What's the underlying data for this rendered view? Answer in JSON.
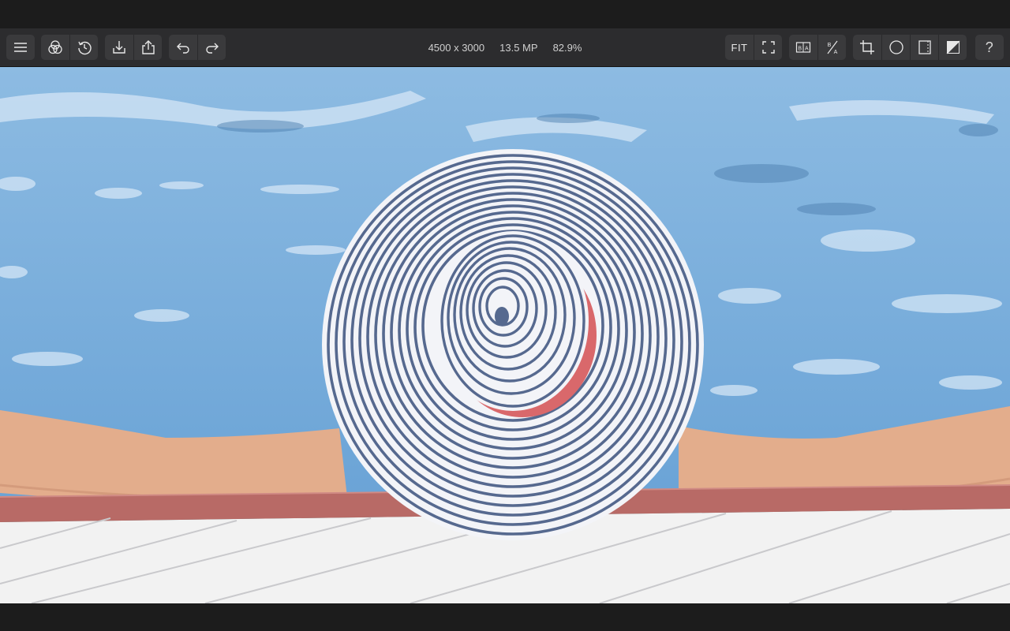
{
  "toolbar": {
    "image_dimensions": "4500 x 3000",
    "megapixels": "13.5 MP",
    "zoom": "82.9%",
    "fit_label": "FIT",
    "help_label": "?",
    "left_groups": [
      [
        "menu-icon"
      ],
      [
        "filters-icon",
        "history-icon"
      ],
      [
        "import-icon",
        "export-icon"
      ],
      [
        "undo-icon",
        "redo-icon"
      ]
    ],
    "right_groups": [
      [
        "fit-button",
        "fullscreen-icon"
      ],
      [
        "before-after-icon",
        "split-compare-icon"
      ],
      [
        "crop-icon",
        "vignette-icon",
        "frame-icon",
        "overlay-icon"
      ],
      [
        "help-button"
      ]
    ]
  },
  "canvas": {
    "subject": "photo-woman-striped-sunhat-in-pool",
    "colors": {
      "water": "#7fb0dc",
      "water_light": "#c8def2",
      "hat_stripe": "#56698f",
      "hat_white": "#f3f4f8",
      "hat_band": "#d9686b",
      "skin": "#e3ad8c",
      "pool_edge": "#b86a66",
      "deck": "#f2f2f2"
    }
  }
}
